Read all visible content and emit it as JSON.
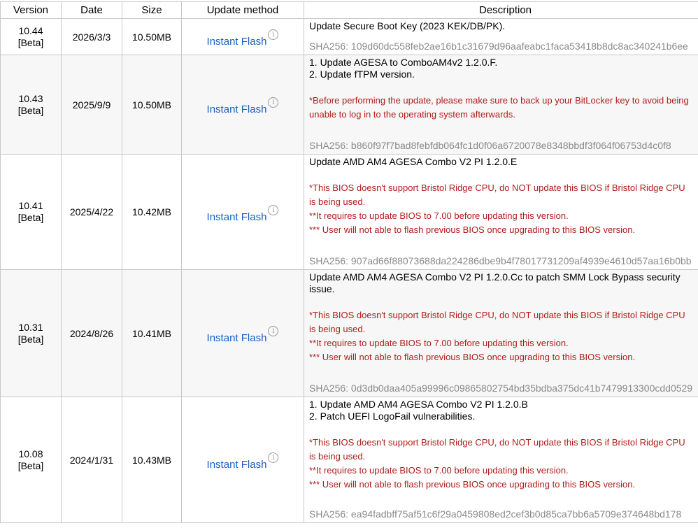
{
  "columns": {
    "version": "Version",
    "date": "Date",
    "size": "Size",
    "method": "Update method",
    "description": "Description"
  },
  "rows": [
    {
      "version_num": "10.44",
      "version_tag": "[Beta]",
      "date": "2026/3/3",
      "size": "10.50MB",
      "method": "Instant Flash",
      "desc_lines": [
        "Update Secure Boot Key (2023 KEK/DB/PK)."
      ],
      "warnings": [],
      "sha": "SHA256: 109d60dc558feb2ae16b1c31679d96aafeabc1faca53418b8dc8ac340241b6ee"
    },
    {
      "version_num": "10.43",
      "version_tag": "[Beta]",
      "date": "2025/9/9",
      "size": "10.50MB",
      "method": "Instant Flash",
      "desc_lines": [
        "1. Update AGESA to ComboAM4v2 1.2.0.F.",
        "2. Update fTPM version."
      ],
      "warnings": [
        "*Before performing the update, please make sure to back up your BitLocker key to avoid being unable to log in to the operating system afterwards."
      ],
      "sha": "SHA256: b860f97f7bad8febfdb064fc1d0f06a6720078e8348bbdf3f064f06753d4c0f8"
    },
    {
      "version_num": "10.41",
      "version_tag": "[Beta]",
      "date": "2025/4/22",
      "size": "10.42MB",
      "method": "Instant Flash",
      "desc_lines": [
        "Update AMD AM4 AGESA Combo V2 PI 1.2.0.E"
      ],
      "warnings": [
        "*This BIOS doesn't support Bristol Ridge CPU, do NOT update this BIOS if Bristol Ridge CPU is being used.",
        "**It requires to update BIOS to 7.00 before updating this version.",
        "*** User will not able to flash previous BIOS once upgrading to this BIOS version."
      ],
      "sha": "SHA256: 907ad66f88073688da224286dbe9b4f78017731209af4939e4610d57aa16b0bb"
    },
    {
      "version_num": "10.31",
      "version_tag": "[Beta]",
      "date": "2024/8/26",
      "size": "10.41MB",
      "method": "Instant Flash",
      "desc_lines": [
        "Update AMD AM4 AGESA Combo V2 PI 1.2.0.Cc to patch SMM Lock Bypass security issue."
      ],
      "warnings": [
        "*This BIOS doesn't support Bristol Ridge CPU, do NOT update this BIOS if Bristol Ridge CPU is being used.",
        "**It requires to update BIOS to 7.00 before updating this version.",
        "*** User will not able to flash previous BIOS once upgrading to this BIOS version."
      ],
      "sha": "SHA256: 0d3db0daa405a99996c09865802754bd35bdba375dc41b7479913300cdd0529"
    },
    {
      "version_num": "10.08",
      "version_tag": "[Beta]",
      "date": "2024/1/31",
      "size": "10.43MB",
      "method": "Instant Flash",
      "desc_lines": [
        "1. Update AMD AM4 AGESA Combo V2 PI 1.2.0.B",
        "2. Patch UEFI LogoFail vulnerabilities."
      ],
      "warnings": [
        "*This BIOS doesn't support Bristol Ridge CPU, do NOT update this BIOS if Bristol Ridge CPU is being used.",
        "**It requires to update BIOS to 7.00 before updating this version.",
        "*** User will not able to flash previous BIOS once upgrading to this BIOS version."
      ],
      "sha": "SHA256: ea94fadbff75af51c6f29a0459808ed2cef3b0d85ca7bb6a5709e374648bd178"
    }
  ]
}
